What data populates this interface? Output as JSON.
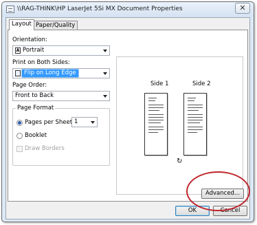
{
  "window": {
    "title": "\\\\RAG-THINK\\HP LaserJet 5Si MX Document Properties",
    "close_glyph": "✕"
  },
  "tabs": [
    {
      "label": "Layout",
      "active": true
    },
    {
      "label": "Paper/Quality",
      "active": false
    }
  ],
  "orientation": {
    "label": "Orientation:",
    "value": "Portrait",
    "icon": "A"
  },
  "duplex": {
    "label": "Print on Both Sides:",
    "value": "Flip on Long Edge"
  },
  "page_order": {
    "label": "Page Order:",
    "value": "Front to Back"
  },
  "page_format": {
    "legend": "Page Format",
    "pages_per_sheet_label": "Pages per Sheet",
    "pages_per_sheet_value": "1",
    "booklet_label": "Booklet",
    "draw_borders_label": "Draw Borders"
  },
  "preview": {
    "side1_label": "Side 1",
    "side2_label": "Side 2",
    "rotate_glyph": "↻"
  },
  "buttons": {
    "advanced": "Advanced...",
    "ok": "OK",
    "cancel": "Cancel"
  },
  "colors": {
    "accent_selection": "#3399ff",
    "annotation_circle": "#c0262c"
  }
}
